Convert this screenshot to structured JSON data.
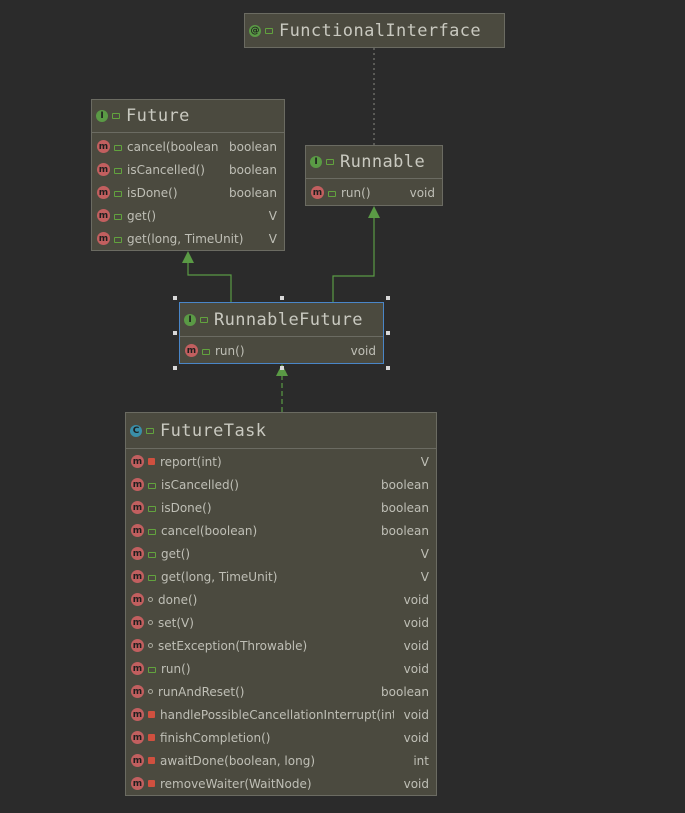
{
  "nodes": {
    "functional_interface": {
      "title": "FunctionalInterface",
      "kind": "@",
      "members": []
    },
    "future": {
      "title": "Future",
      "kind": "I",
      "members": [
        {
          "badge": "m",
          "visibility": "public",
          "name": "cancel(boolean)",
          "type": "boolean"
        },
        {
          "badge": "m",
          "visibility": "public",
          "name": "isCancelled()",
          "type": "boolean"
        },
        {
          "badge": "m",
          "visibility": "public",
          "name": "isDone()",
          "type": "boolean"
        },
        {
          "badge": "m",
          "visibility": "public",
          "name": "get()",
          "type": "V"
        },
        {
          "badge": "m",
          "visibility": "public",
          "name": "get(long, TimeUnit)",
          "type": "V"
        }
      ]
    },
    "runnable": {
      "title": "Runnable",
      "kind": "I",
      "members": [
        {
          "badge": "m",
          "visibility": "public",
          "name": "run()",
          "type": "void"
        }
      ]
    },
    "runnable_future": {
      "title": "RunnableFuture",
      "kind": "I",
      "members": [
        {
          "badge": "m",
          "visibility": "public",
          "name": "run()",
          "type": "void"
        }
      ]
    },
    "future_task": {
      "title": "FutureTask",
      "kind": "C",
      "members": [
        {
          "badge": "m",
          "visibility": "private",
          "name": "report(int)",
          "type": "V"
        },
        {
          "badge": "m",
          "visibility": "public",
          "name": "isCancelled()",
          "type": "boolean"
        },
        {
          "badge": "m",
          "visibility": "public",
          "name": "isDone()",
          "type": "boolean"
        },
        {
          "badge": "m",
          "visibility": "public",
          "name": "cancel(boolean)",
          "type": "boolean"
        },
        {
          "badge": "m",
          "visibility": "public",
          "name": "get()",
          "type": "V"
        },
        {
          "badge": "m",
          "visibility": "public",
          "name": "get(long, TimeUnit)",
          "type": "V"
        },
        {
          "badge": "m",
          "visibility": "package",
          "name": "done()",
          "type": "void"
        },
        {
          "badge": "m",
          "visibility": "package",
          "name": "set(V)",
          "type": "void"
        },
        {
          "badge": "m",
          "visibility": "package",
          "name": "setException(Throwable)",
          "type": "void"
        },
        {
          "badge": "m",
          "visibility": "public",
          "name": "run()",
          "type": "void"
        },
        {
          "badge": "m",
          "visibility": "package",
          "name": "runAndReset()",
          "type": "boolean"
        },
        {
          "badge": "m",
          "visibility": "private",
          "name": "handlePossibleCancellationInterrupt(int)",
          "type": "void"
        },
        {
          "badge": "m",
          "visibility": "private",
          "name": "finishCompletion()",
          "type": "void"
        },
        {
          "badge": "m",
          "visibility": "private",
          "name": "awaitDone(boolean, long)",
          "type": "int"
        },
        {
          "badge": "m",
          "visibility": "private",
          "name": "removeWaiter(WaitNode)",
          "type": "void"
        }
      ]
    }
  },
  "colors": {
    "background": "#2b2b2b",
    "node_fill": "#4b4a3f",
    "extends_edge": "#5a9a45",
    "selection": "#4a86c8"
  }
}
